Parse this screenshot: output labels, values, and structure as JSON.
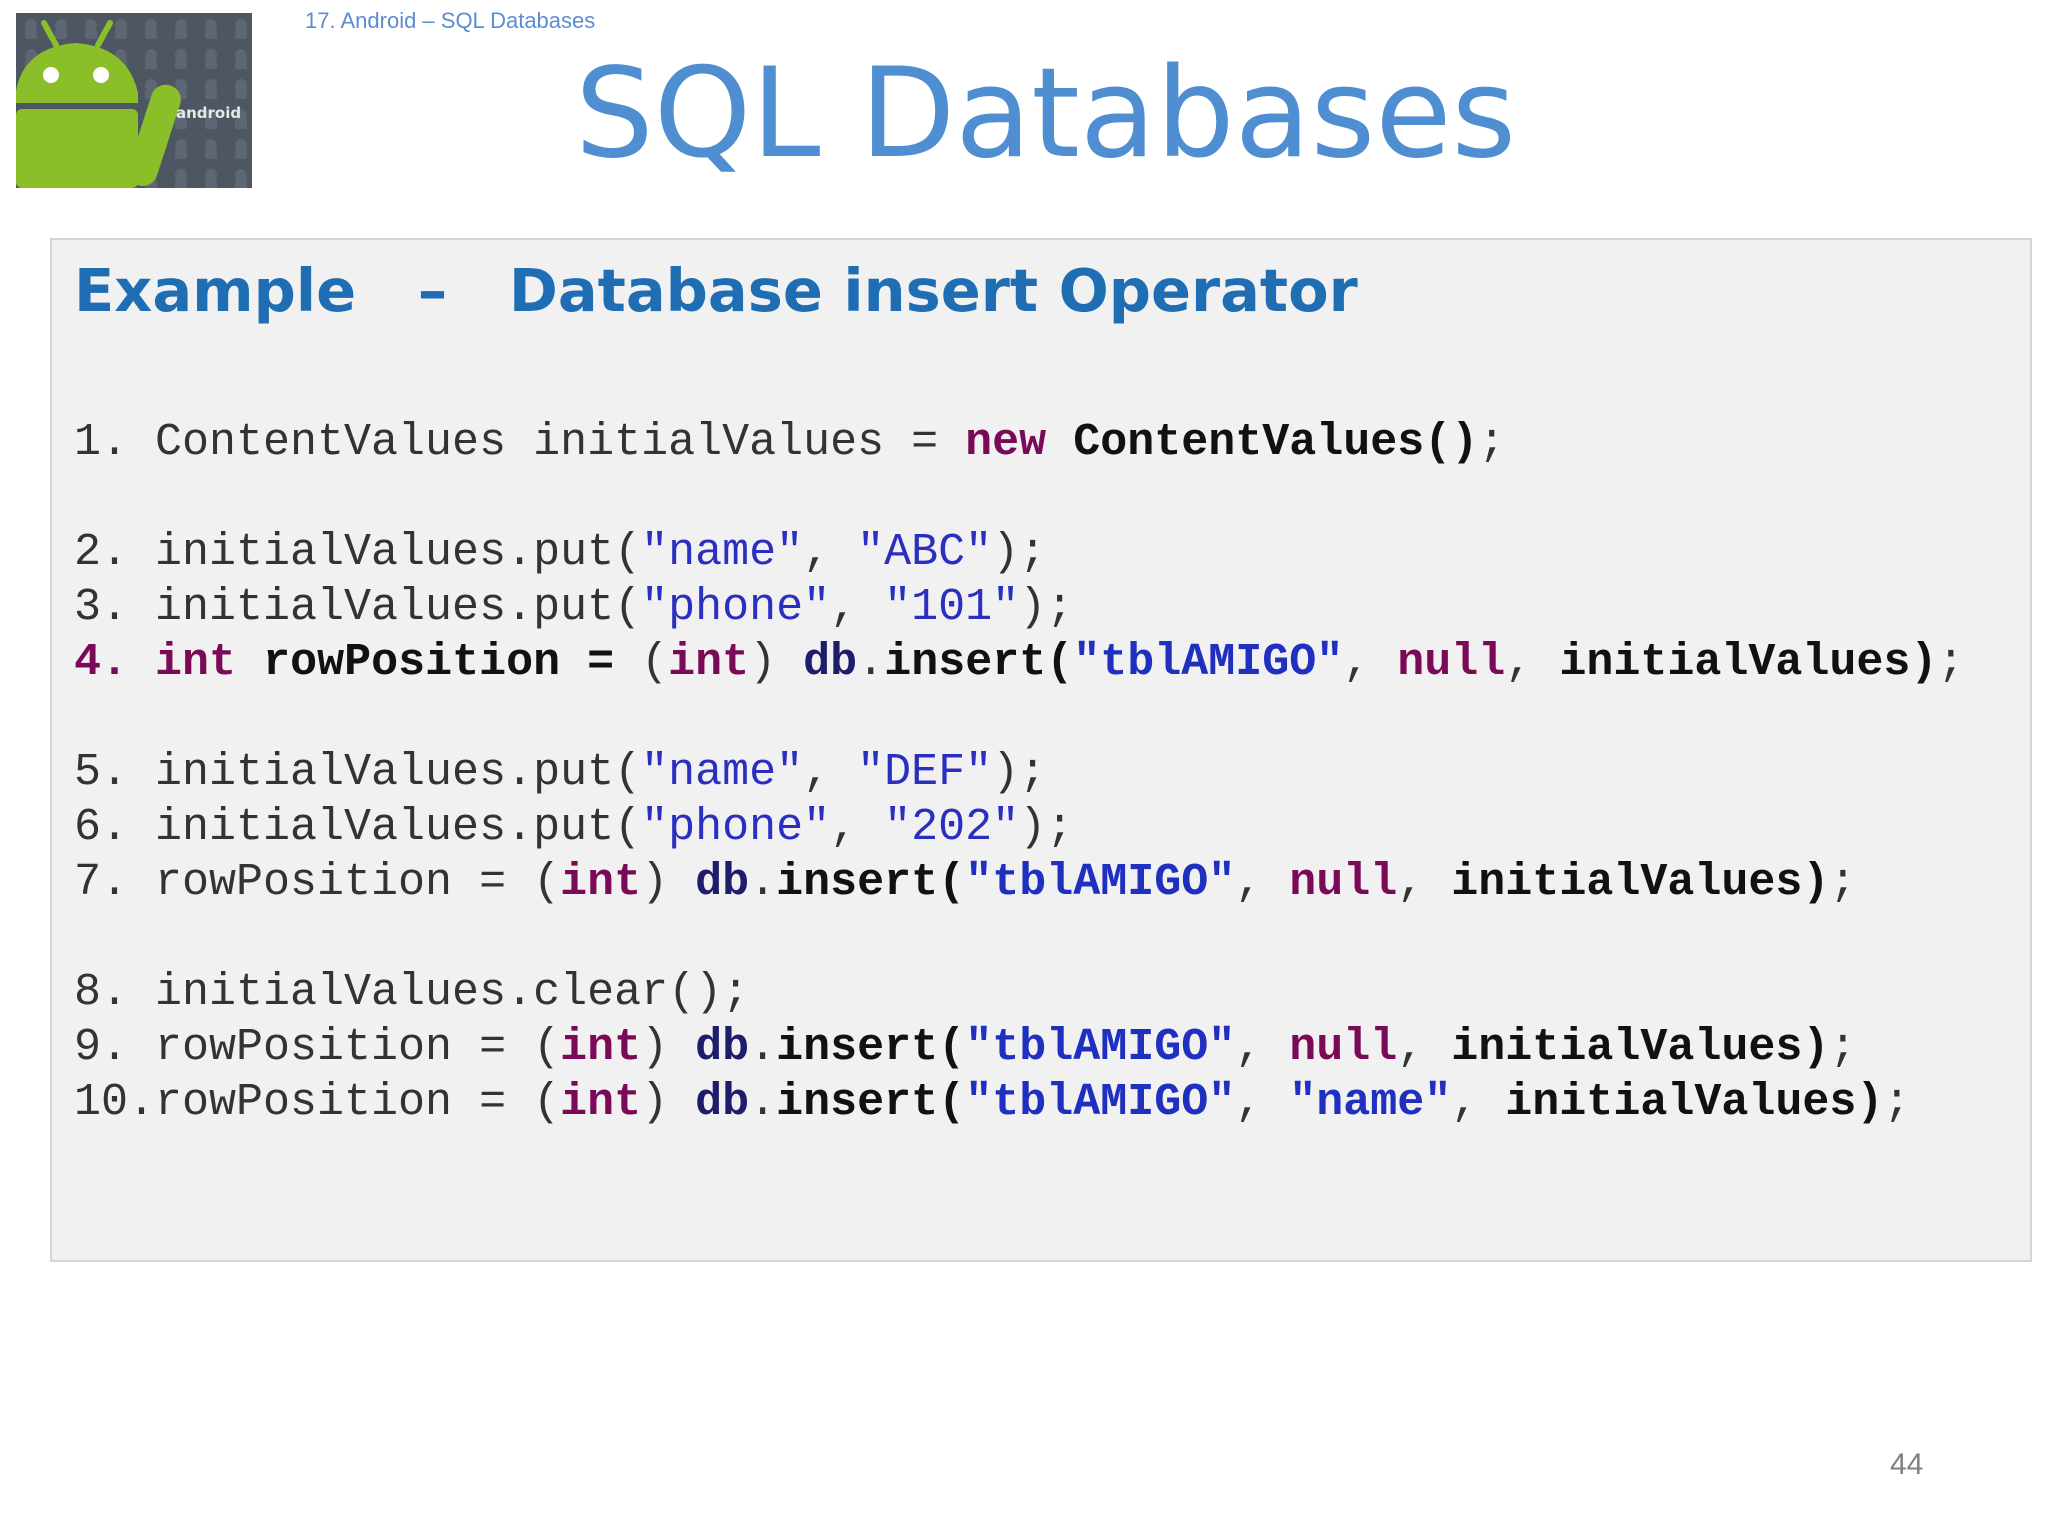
{
  "header": {
    "subtitle": "17. Android – SQL Databases",
    "title": "SQL Databases",
    "logo_text": "android"
  },
  "example": {
    "heading": "Example   –   Database insert Operator",
    "lines": [
      "1. ContentValues initialValues = new ContentValues();",
      "2. initialValues.put(\"name\", \"ABC\");",
      "3. initialValues.put(\"phone\", \"101\");",
      "4. int rowPosition = (int) db.insert(\"tblAMIGO\", null, initialValues);",
      "5. initialValues.put(\"name\", \"DEF\");",
      "6. initialValues.put(\"phone\", \"202\");",
      "7. rowPosition = (int) db.insert(\"tblAMIGO\", null, initialValues);",
      "8. initialValues.clear();",
      "9. rowPosition = (int) db.insert(\"tblAMIGO\", null, initialValues);",
      "10.rowPosition = (int) db.insert(\"tblAMIGO\", \"name\", initialValues);"
    ]
  },
  "footer": {
    "page_number": "44"
  },
  "colors": {
    "title": "#4f8fd1",
    "heading": "#1f6db3",
    "keyword": "#7a0a57",
    "string": "#2a2fc0",
    "panel_bg": "#f1f1f1"
  },
  "icons": [
    "android-logo-icon"
  ]
}
